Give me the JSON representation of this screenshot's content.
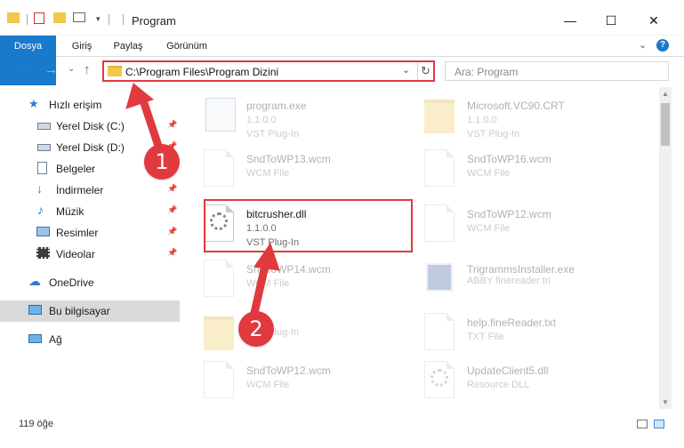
{
  "window": {
    "title": "Program",
    "minimize_glyph": "—",
    "maximize_glyph": "☐",
    "close_glyph": "✕"
  },
  "ribbon": {
    "tabs": [
      "Dosya",
      "Giriş",
      "Paylaş",
      "Görünüm"
    ],
    "expand_glyph": "⌄",
    "help_glyph": "?"
  },
  "nav": {
    "back_glyph": "←",
    "forward_glyph": "→",
    "recent_glyph": "⌄",
    "up_glyph": "↑"
  },
  "address": {
    "path": "C:\\Program Files\\Program Dizini",
    "dropdown_glyph": "⌄",
    "refresh_glyph": "↻"
  },
  "search": {
    "placeholder": "Ara: Program"
  },
  "sidebar": {
    "items": [
      {
        "label": "Hızlı erişim",
        "icon": "star-icon"
      },
      {
        "label": "Yerel Disk (C:)",
        "icon": "drive-icon",
        "pinned": true
      },
      {
        "label": "Yerel Disk (D:)",
        "icon": "drive-icon",
        "pinned": true
      },
      {
        "label": "Belgeler",
        "icon": "documents-icon",
        "pinned": true
      },
      {
        "label": "İndirmeler",
        "icon": "download-icon",
        "pinned": true
      },
      {
        "label": "Müzik",
        "icon": "music-icon",
        "pinned": true
      },
      {
        "label": "Resimler",
        "icon": "pictures-icon",
        "pinned": true
      },
      {
        "label": "Videolar",
        "icon": "videos-icon",
        "pinned": true
      },
      {
        "label": "OneDrive",
        "icon": "cloud-icon"
      },
      {
        "label": "Bu bilgisayar",
        "icon": "computer-icon"
      },
      {
        "label": "Ağ",
        "icon": "network-icon"
      }
    ],
    "pin_glyph": "📌"
  },
  "files": {
    "left": [
      {
        "name": "program.exe",
        "line2": "1.1.0.0",
        "line3": "VST Plug-In"
      },
      {
        "name": "SndToWP13.wcm",
        "line2": "WCM File"
      },
      {
        "name": "bitcrusher.dll",
        "line2": "1.1.0.0",
        "line3": "VST Plug-In"
      },
      {
        "name": "SndToWP14.wcm",
        "line2": "WCM File"
      },
      {
        "name": "",
        "line2": "VST Plug-In"
      },
      {
        "name": "SndToWP12.wcm",
        "line2": "WCM File"
      }
    ],
    "right": [
      {
        "name": "Microsoft.VC90.CRT",
        "line2": "1.1.0.0",
        "line3": "VST Plug-In"
      },
      {
        "name": "SndToWP16.wcm",
        "line2": "WCM File"
      },
      {
        "name": "SndToWP12.wcm",
        "line2": "WCM File"
      },
      {
        "name": "TrigrammsInstaller.exe",
        "line2": "ABBY finereader tri"
      },
      {
        "name": "help.fineReader.txt",
        "line2": "TXT File"
      },
      {
        "name": "UpdateClient5.dll",
        "line2": "Resource DLL"
      }
    ]
  },
  "status": {
    "item_count": "119 öğe"
  },
  "callouts": {
    "step1": "1",
    "step2": "2"
  },
  "colors": {
    "accent": "#1979ca",
    "annotation": "#e0393e"
  }
}
